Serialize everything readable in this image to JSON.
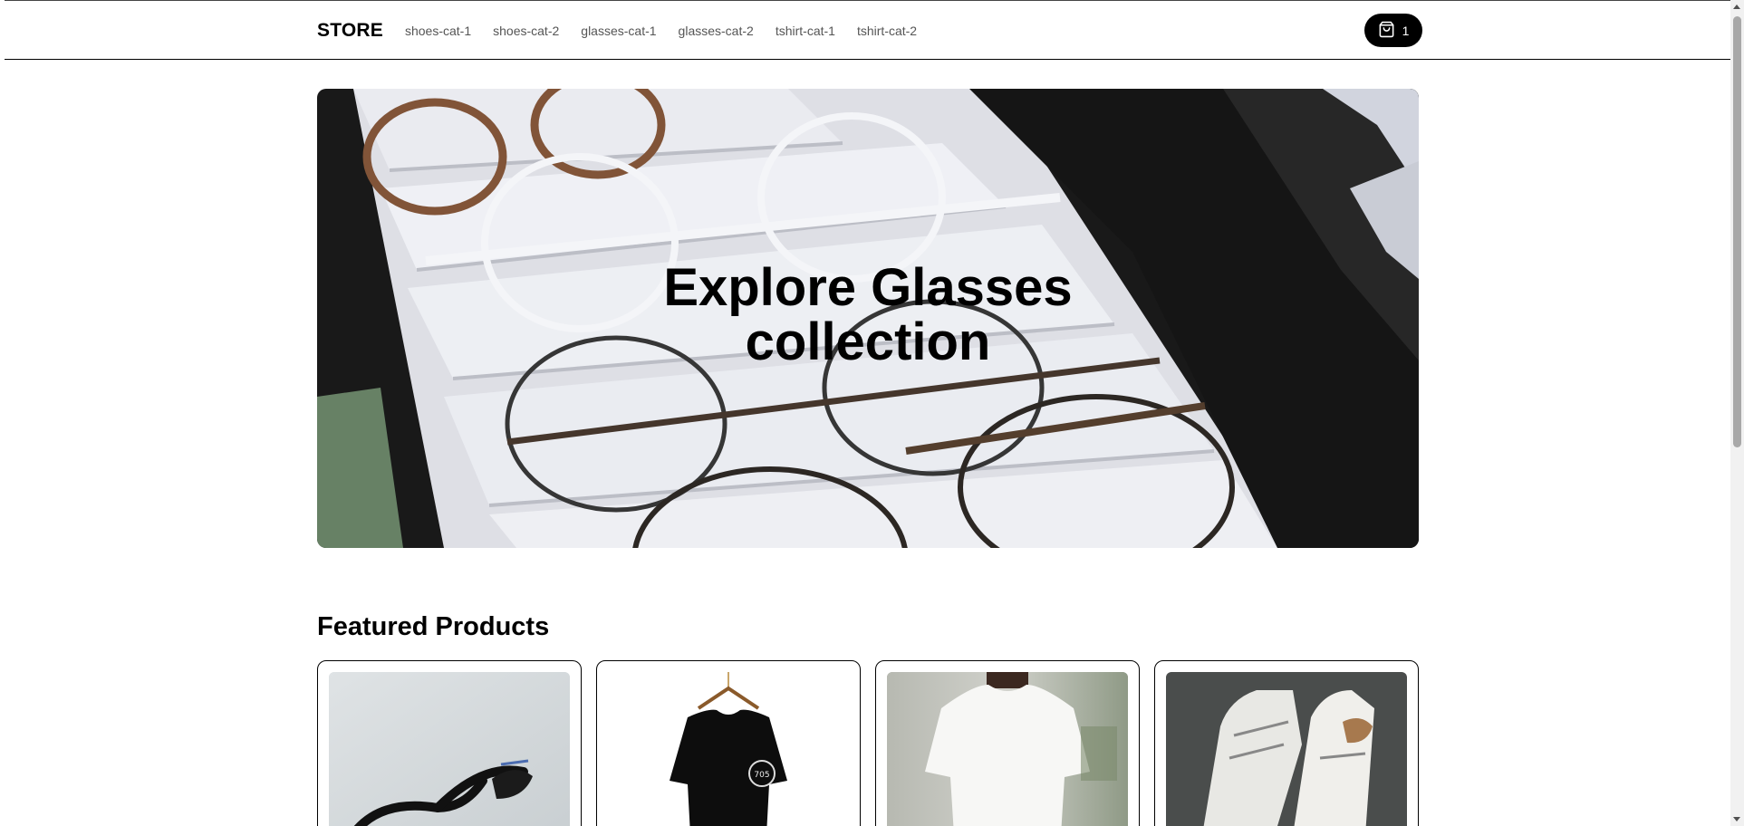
{
  "header": {
    "logo": "STORE",
    "nav": [
      "shoes-cat-1",
      "shoes-cat-2",
      "glasses-cat-1",
      "glasses-cat-2",
      "tshirt-cat-1",
      "tshirt-cat-2"
    ],
    "cart_count": "1",
    "cart_icon": "shopping-bag-icon"
  },
  "hero": {
    "title_line1": "Explore Glasses",
    "title_line2": "collection"
  },
  "featured": {
    "title": "Featured Products",
    "products": [
      {
        "image": "black-eyeglasses"
      },
      {
        "image": "black-tshirt-on-hanger"
      },
      {
        "image": "white-tshirt-on-model"
      },
      {
        "image": "white-high-top-sneakers"
      }
    ]
  },
  "colors": {
    "primary": "#000000",
    "background": "#ffffff",
    "nav_text": "#555555"
  }
}
